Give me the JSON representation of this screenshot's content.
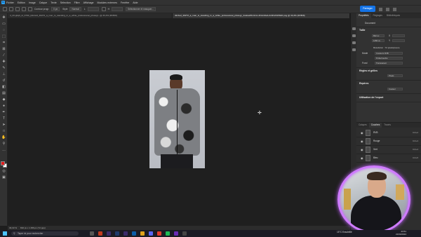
{
  "menubar": {
    "items": [
      "Fichier",
      "Edition",
      "Image",
      "Calque",
      "Texte",
      "Sélection",
      "Filtre",
      "Affichage",
      "Modules externes",
      "Fenêtre",
      "Aide"
    ]
  },
  "options_bar": {
    "style_label": "Contour progr.",
    "style_value": "0 px",
    "mode_label": "Style",
    "mode_value": "Normal",
    "width_label": "L",
    "height_label": "H",
    "mask_button": "Sélectionner et masquer..."
  },
  "share_button": "Partager",
  "tabs": [
    {
      "label": "4_t2t-gbqb_id_9790_(dimlwd_40272_a_man_is_standing_in_a_white_professional_photogr...@ 33,3% (RVB/8)",
      "active": false
    },
    {
      "label": "dimlwd_40272_a_man_is_standing_in_a_white_professional_photogr_4caba236-9c1c-4f4d-b0ab-3c9f12315626.png @ 33,3% (RVB/8)",
      "active": true
    }
  ],
  "status_bar": {
    "zoom": "33,33 %",
    "size": "832 px x 1 456 px (72 ppp)"
  },
  "properties": {
    "tabs": [
      "Propriétés",
      "Réglages",
      "Bibliothèques"
    ],
    "doc_label": "Document",
    "section_size": "Taille",
    "w_value": "832 px",
    "h_value": "1456 px",
    "x_label": "X",
    "y_label": "Y",
    "resolution": "Résolution : 72 pixels/pouce",
    "mode_label": "Mode",
    "mode_value": "Couleurs RVB",
    "depth_value": "8 bits/couche",
    "fill_label": "Fond",
    "fill_value": "Transparent",
    "section_rulers": "Règles et grilles",
    "ruler_unit": "Pixels",
    "section_guides": "Repères",
    "guide_value": "Couleur",
    "section_export": "Utilisation de l'export",
    "section_actions": "Actions rapides"
  },
  "layers": {
    "tabs": [
      "Calques",
      "Couches",
      "Tracés"
    ],
    "items": [
      {
        "name": "RVB",
        "shortcut": "Ctrl+2"
      },
      {
        "name": "Rouge",
        "shortcut": "Ctrl+3"
      },
      {
        "name": "Vert",
        "shortcut": "Ctrl+4"
      },
      {
        "name": "Bleu",
        "shortcut": "Ctrl+5"
      }
    ]
  },
  "taskbar": {
    "search_placeholder": "Taper ici pour rechercher",
    "weather": "15°C  Ensoleillé",
    "time": "23:51",
    "date": "21/03/2024"
  },
  "colors": {
    "foreground": "#e21b1b",
    "background": "#ffffff",
    "accent": "#1473e6",
    "webcam_ring": "#cf7bff"
  }
}
